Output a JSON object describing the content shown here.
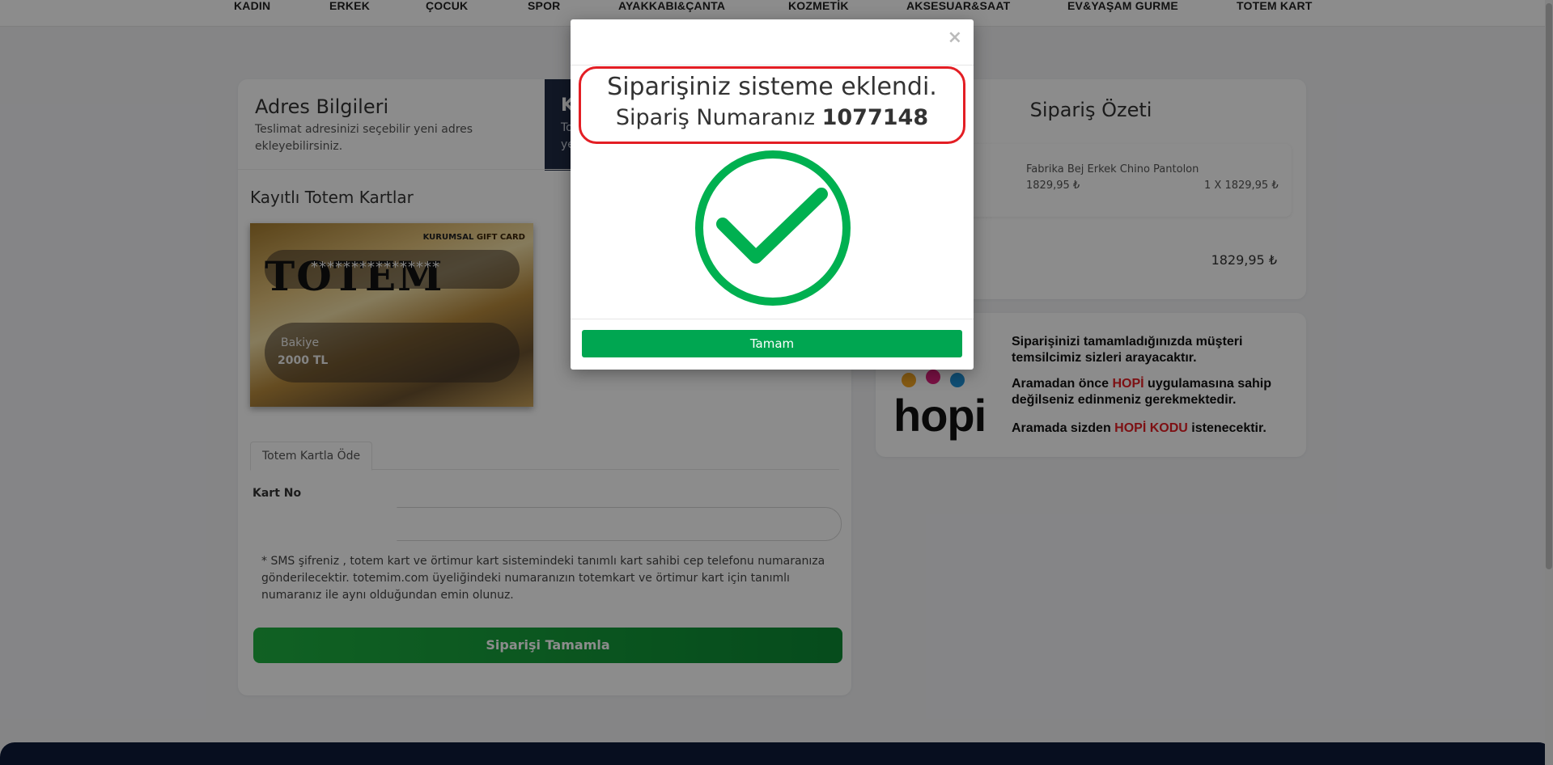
{
  "nav": {
    "items": [
      "KADIN",
      "ERKEK",
      "ÇOCUK",
      "SPOR",
      "AYAKKABI&ÇANTA",
      "KOZMETİK",
      "AKSESUAR&SAAT",
      "EV&YAŞAM GURME",
      "TOTEM KART"
    ]
  },
  "address": {
    "title": "Adres Bilgileri",
    "subtitle": "Teslimat adresinizi seçebilir yeni adres ekleyebilirsiniz.",
    "side_title": "K",
    "side_line1": "To",
    "side_line2": "ye"
  },
  "saved_cards": {
    "title": "Kayıtlı Totem Kartlar",
    "corporate_label": "KURUMSAL",
    "gift_card_label": "GIFT CARD",
    "brand": "TOTEM",
    "masked_number": "****************",
    "balance_label": "Bakiye",
    "balance_value": "2000 TL"
  },
  "payment": {
    "tab_label": "Totem Kartla Öde",
    "card_no_label": "Kart No",
    "sms_note": "* SMS şifreniz , totem kart ve örtimur kart sistemindeki tanımlı kart sahibi cep telefonu numaranıza gönderilecektir. totemim.com üyeliğindeki numaranızın totemkart ve örtimur kart için tanımlı numaranız ile aynı olduğundan emin olunuz.",
    "complete_button": "Siparişi Tamamla"
  },
  "summary": {
    "title": "Sipariş Özeti",
    "item_name": "Fabrika Bej Erkek Chino Pantolon",
    "item_price": "1829,95 ₺",
    "item_qty": "1 X 1829,95 ₺",
    "total": "1829,95 ₺"
  },
  "hopi": {
    "logo_text": "hopi",
    "line1": "Siparişinizi tamamladığınızda müşteri temsilcimiz sizleri arayacaktır.",
    "line2_pre": "Aramadan önce ",
    "line2_brand": "HOPİ",
    "line2_post": " uygulamasına sahip değilseniz edinmeniz gerekmektedir.",
    "line3_pre": "Aramada sizden ",
    "line3_brand": "HOPİ KODU",
    "line3_post": " istenecektir."
  },
  "modal": {
    "close_symbol": "×",
    "message_line1": "Siparişiniz sisteme eklendi.",
    "message_line2_prefix": "Sipariş Numaranız ",
    "order_number": "1077148",
    "ok_button": "Tamam"
  },
  "colors": {
    "success_green": "#00a651",
    "highlight_red": "#e31e24",
    "navy": "#0e1a3a"
  },
  "icons": {
    "modal_check": "check-circle-icon",
    "close": "close-icon"
  }
}
